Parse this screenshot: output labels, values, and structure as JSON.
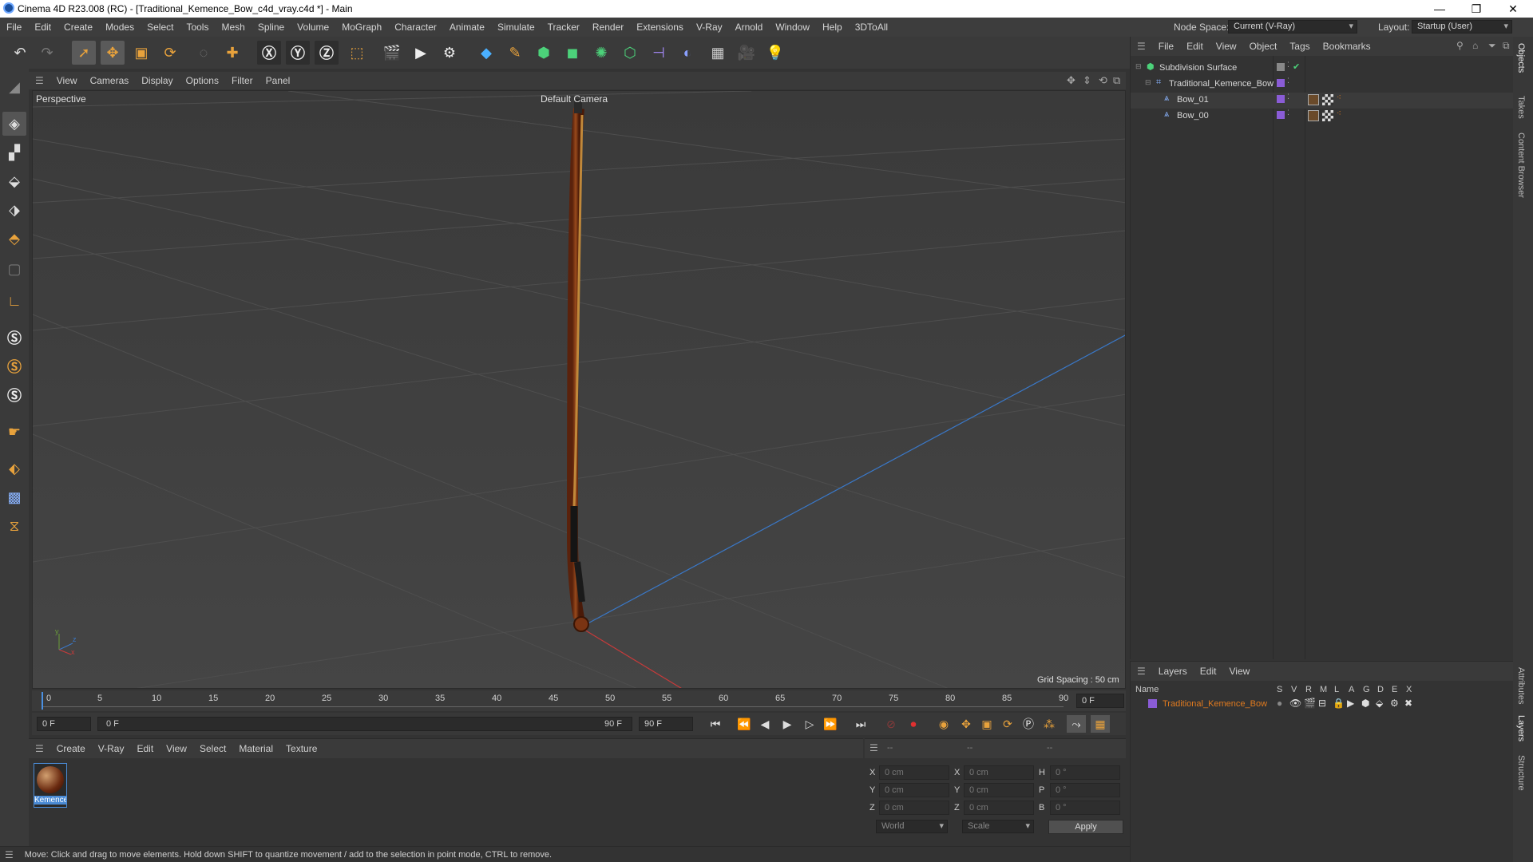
{
  "window": {
    "title": "Cinema 4D R23.008 (RC) - [Traditional_Kemence_Bow_c4d_vray.c4d *] - Main",
    "minimize": "—",
    "maximize": "❐",
    "close": "✕"
  },
  "menubar": {
    "items": [
      "File",
      "Edit",
      "Create",
      "Modes",
      "Select",
      "Tools",
      "Mesh",
      "Spline",
      "Volume",
      "MoGraph",
      "Character",
      "Animate",
      "Simulate",
      "Tracker",
      "Render",
      "Extensions",
      "V-Ray",
      "Arnold",
      "Window",
      "Help",
      "3DToAll"
    ],
    "node_space_label": "Node Space:",
    "node_space_value": "Current (V-Ray)",
    "layout_label": "Layout:",
    "layout_value": "Startup (User)"
  },
  "viewport": {
    "menu": [
      "View",
      "Cameras",
      "Display",
      "Options",
      "Filter",
      "Panel"
    ],
    "view_name": "Perspective",
    "camera": "Default Camera",
    "grid_spacing": "Grid Spacing : 50 cm",
    "axis_y": "y",
    "axis_z": "z",
    "axis_x": "x"
  },
  "timeline": {
    "ticks": [
      "0",
      "5",
      "10",
      "15",
      "20",
      "25",
      "30",
      "35",
      "40",
      "45",
      "50",
      "55",
      "60",
      "65",
      "70",
      "75",
      "80",
      "85",
      "90"
    ],
    "current_frame_right": "0 F",
    "start_frame": "0 F",
    "range_start": "0 F",
    "range_end": "90 F",
    "end_frame": "90 F"
  },
  "material_panel": {
    "menu": [
      "Create",
      "V-Ray",
      "Edit",
      "View",
      "Select",
      "Material",
      "Texture"
    ],
    "material_name": "Kemence"
  },
  "coords_panel": {
    "header": [
      "--",
      "--",
      "--"
    ],
    "rows": [
      {
        "a": "X",
        "av": "0 cm",
        "b": "X",
        "bv": "0 cm",
        "c": "H",
        "cv": "0 °"
      },
      {
        "a": "Y",
        "av": "0 cm",
        "b": "Y",
        "bv": "0 cm",
        "c": "P",
        "cv": "0 °"
      },
      {
        "a": "Z",
        "av": "0 cm",
        "b": "Z",
        "bv": "0 cm",
        "c": "B",
        "cv": "0 °"
      }
    ],
    "world": "World",
    "scale": "Scale",
    "apply": "Apply"
  },
  "object_manager": {
    "menu": [
      "File",
      "Edit",
      "View",
      "Object",
      "Tags",
      "Bookmarks"
    ],
    "objects": [
      {
        "name": "Subdivision Surface",
        "level": 0
      },
      {
        "name": "Traditional_Kemence_Bow",
        "level": 1
      },
      {
        "name": "Bow_01",
        "level": 2
      },
      {
        "name": "Bow_00",
        "level": 2
      }
    ]
  },
  "layer_manager": {
    "menu": [
      "Layers",
      "Edit",
      "View"
    ],
    "col_name": "Name",
    "col_flags": [
      "S",
      "V",
      "R",
      "M",
      "L",
      "A",
      "G",
      "D",
      "E",
      "X"
    ],
    "layer_name": "Traditional_Kemence_Bow"
  },
  "side_tabs": [
    "Objects",
    "Takes",
    "Content Browser",
    "Attributes",
    "Layers",
    "Structure"
  ],
  "status": {
    "text": "Move: Click and drag to move elements. Hold down SHIFT to quantize movement / add to the selection in point mode, CTRL to remove."
  },
  "colors": {
    "accent_orange": "#e07a1f",
    "layer_purple": "#8a5cd6",
    "axis_blue": "#3a78c8",
    "axis_red": "#c83a3a",
    "bow_wood": "#7a3413"
  }
}
